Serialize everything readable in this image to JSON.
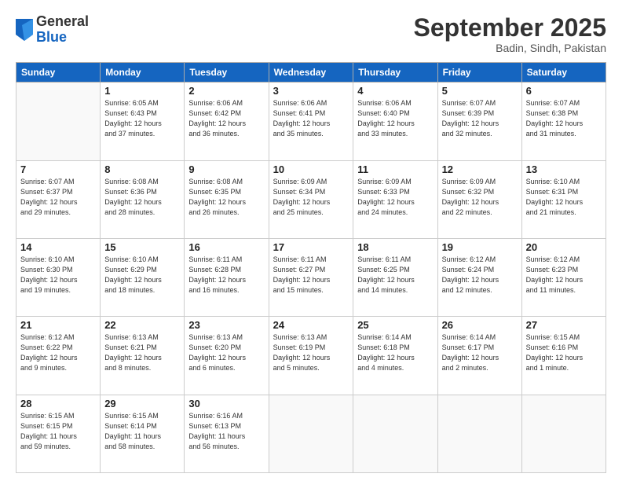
{
  "logo": {
    "general": "General",
    "blue": "Blue"
  },
  "header": {
    "month": "September 2025",
    "location": "Badin, Sindh, Pakistan"
  },
  "days_header": [
    "Sunday",
    "Monday",
    "Tuesday",
    "Wednesday",
    "Thursday",
    "Friday",
    "Saturday"
  ],
  "weeks": [
    [
      {
        "day": "",
        "info": ""
      },
      {
        "day": "1",
        "info": "Sunrise: 6:05 AM\nSunset: 6:43 PM\nDaylight: 12 hours\nand 37 minutes."
      },
      {
        "day": "2",
        "info": "Sunrise: 6:06 AM\nSunset: 6:42 PM\nDaylight: 12 hours\nand 36 minutes."
      },
      {
        "day": "3",
        "info": "Sunrise: 6:06 AM\nSunset: 6:41 PM\nDaylight: 12 hours\nand 35 minutes."
      },
      {
        "day": "4",
        "info": "Sunrise: 6:06 AM\nSunset: 6:40 PM\nDaylight: 12 hours\nand 33 minutes."
      },
      {
        "day": "5",
        "info": "Sunrise: 6:07 AM\nSunset: 6:39 PM\nDaylight: 12 hours\nand 32 minutes."
      },
      {
        "day": "6",
        "info": "Sunrise: 6:07 AM\nSunset: 6:38 PM\nDaylight: 12 hours\nand 31 minutes."
      }
    ],
    [
      {
        "day": "7",
        "info": "Sunrise: 6:07 AM\nSunset: 6:37 PM\nDaylight: 12 hours\nand 29 minutes."
      },
      {
        "day": "8",
        "info": "Sunrise: 6:08 AM\nSunset: 6:36 PM\nDaylight: 12 hours\nand 28 minutes."
      },
      {
        "day": "9",
        "info": "Sunrise: 6:08 AM\nSunset: 6:35 PM\nDaylight: 12 hours\nand 26 minutes."
      },
      {
        "day": "10",
        "info": "Sunrise: 6:09 AM\nSunset: 6:34 PM\nDaylight: 12 hours\nand 25 minutes."
      },
      {
        "day": "11",
        "info": "Sunrise: 6:09 AM\nSunset: 6:33 PM\nDaylight: 12 hours\nand 24 minutes."
      },
      {
        "day": "12",
        "info": "Sunrise: 6:09 AM\nSunset: 6:32 PM\nDaylight: 12 hours\nand 22 minutes."
      },
      {
        "day": "13",
        "info": "Sunrise: 6:10 AM\nSunset: 6:31 PM\nDaylight: 12 hours\nand 21 minutes."
      }
    ],
    [
      {
        "day": "14",
        "info": "Sunrise: 6:10 AM\nSunset: 6:30 PM\nDaylight: 12 hours\nand 19 minutes."
      },
      {
        "day": "15",
        "info": "Sunrise: 6:10 AM\nSunset: 6:29 PM\nDaylight: 12 hours\nand 18 minutes."
      },
      {
        "day": "16",
        "info": "Sunrise: 6:11 AM\nSunset: 6:28 PM\nDaylight: 12 hours\nand 16 minutes."
      },
      {
        "day": "17",
        "info": "Sunrise: 6:11 AM\nSunset: 6:27 PM\nDaylight: 12 hours\nand 15 minutes."
      },
      {
        "day": "18",
        "info": "Sunrise: 6:11 AM\nSunset: 6:25 PM\nDaylight: 12 hours\nand 14 minutes."
      },
      {
        "day": "19",
        "info": "Sunrise: 6:12 AM\nSunset: 6:24 PM\nDaylight: 12 hours\nand 12 minutes."
      },
      {
        "day": "20",
        "info": "Sunrise: 6:12 AM\nSunset: 6:23 PM\nDaylight: 12 hours\nand 11 minutes."
      }
    ],
    [
      {
        "day": "21",
        "info": "Sunrise: 6:12 AM\nSunset: 6:22 PM\nDaylight: 12 hours\nand 9 minutes."
      },
      {
        "day": "22",
        "info": "Sunrise: 6:13 AM\nSunset: 6:21 PM\nDaylight: 12 hours\nand 8 minutes."
      },
      {
        "day": "23",
        "info": "Sunrise: 6:13 AM\nSunset: 6:20 PM\nDaylight: 12 hours\nand 6 minutes."
      },
      {
        "day": "24",
        "info": "Sunrise: 6:13 AM\nSunset: 6:19 PM\nDaylight: 12 hours\nand 5 minutes."
      },
      {
        "day": "25",
        "info": "Sunrise: 6:14 AM\nSunset: 6:18 PM\nDaylight: 12 hours\nand 4 minutes."
      },
      {
        "day": "26",
        "info": "Sunrise: 6:14 AM\nSunset: 6:17 PM\nDaylight: 12 hours\nand 2 minutes."
      },
      {
        "day": "27",
        "info": "Sunrise: 6:15 AM\nSunset: 6:16 PM\nDaylight: 12 hours\nand 1 minute."
      }
    ],
    [
      {
        "day": "28",
        "info": "Sunrise: 6:15 AM\nSunset: 6:15 PM\nDaylight: 11 hours\nand 59 minutes."
      },
      {
        "day": "29",
        "info": "Sunrise: 6:15 AM\nSunset: 6:14 PM\nDaylight: 11 hours\nand 58 minutes."
      },
      {
        "day": "30",
        "info": "Sunrise: 6:16 AM\nSunset: 6:13 PM\nDaylight: 11 hours\nand 56 minutes."
      },
      {
        "day": "",
        "info": ""
      },
      {
        "day": "",
        "info": ""
      },
      {
        "day": "",
        "info": ""
      },
      {
        "day": "",
        "info": ""
      }
    ]
  ]
}
